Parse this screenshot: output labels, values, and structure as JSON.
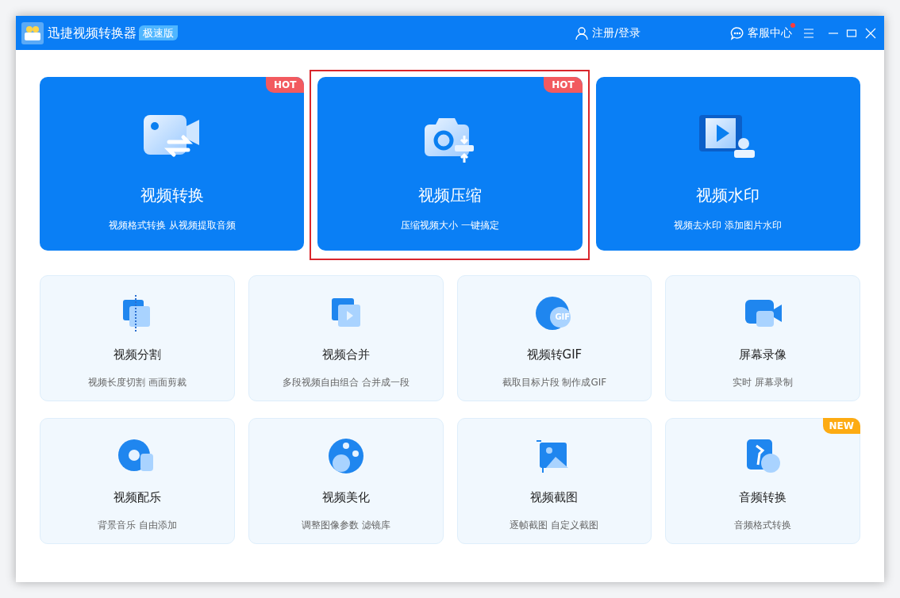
{
  "window": {
    "title": "迅捷视频转换器",
    "edition_badge": "极速版",
    "login": "注册/登录",
    "support": "客服中心",
    "support_unread": true
  },
  "feature_cards": [
    {
      "title": "视频转换",
      "subtitle": "视频格式转换 从视频提取音频",
      "badge": "HOT",
      "highlighted": false
    },
    {
      "title": "视频压缩",
      "subtitle": "压缩视频大小 一键搞定",
      "badge": "HOT",
      "highlighted": true
    },
    {
      "title": "视频水印",
      "subtitle": "视频去水印 添加图片水印",
      "highlighted": false
    }
  ],
  "tool_cards": [
    {
      "title": "视频分割",
      "subtitle": "视频长度切割 画面剪裁"
    },
    {
      "title": "视频合并",
      "subtitle": "多段视频自由组合 合并成一段"
    },
    {
      "title": "视频转GIF",
      "subtitle": "截取目标片段 制作成GIF",
      "icon_label": "GIF"
    },
    {
      "title": "屏幕录像",
      "subtitle": "实时 屏幕录制"
    },
    {
      "title": "视频配乐",
      "subtitle": "背景音乐 自由添加"
    },
    {
      "title": "视频美化",
      "subtitle": "调整图像参数 滤镜库"
    },
    {
      "title": "视频截图",
      "subtitle": "逐帧截图 自定义截图"
    },
    {
      "title": "音频转换",
      "subtitle": "音频格式转换",
      "badge": "NEW"
    }
  ]
}
